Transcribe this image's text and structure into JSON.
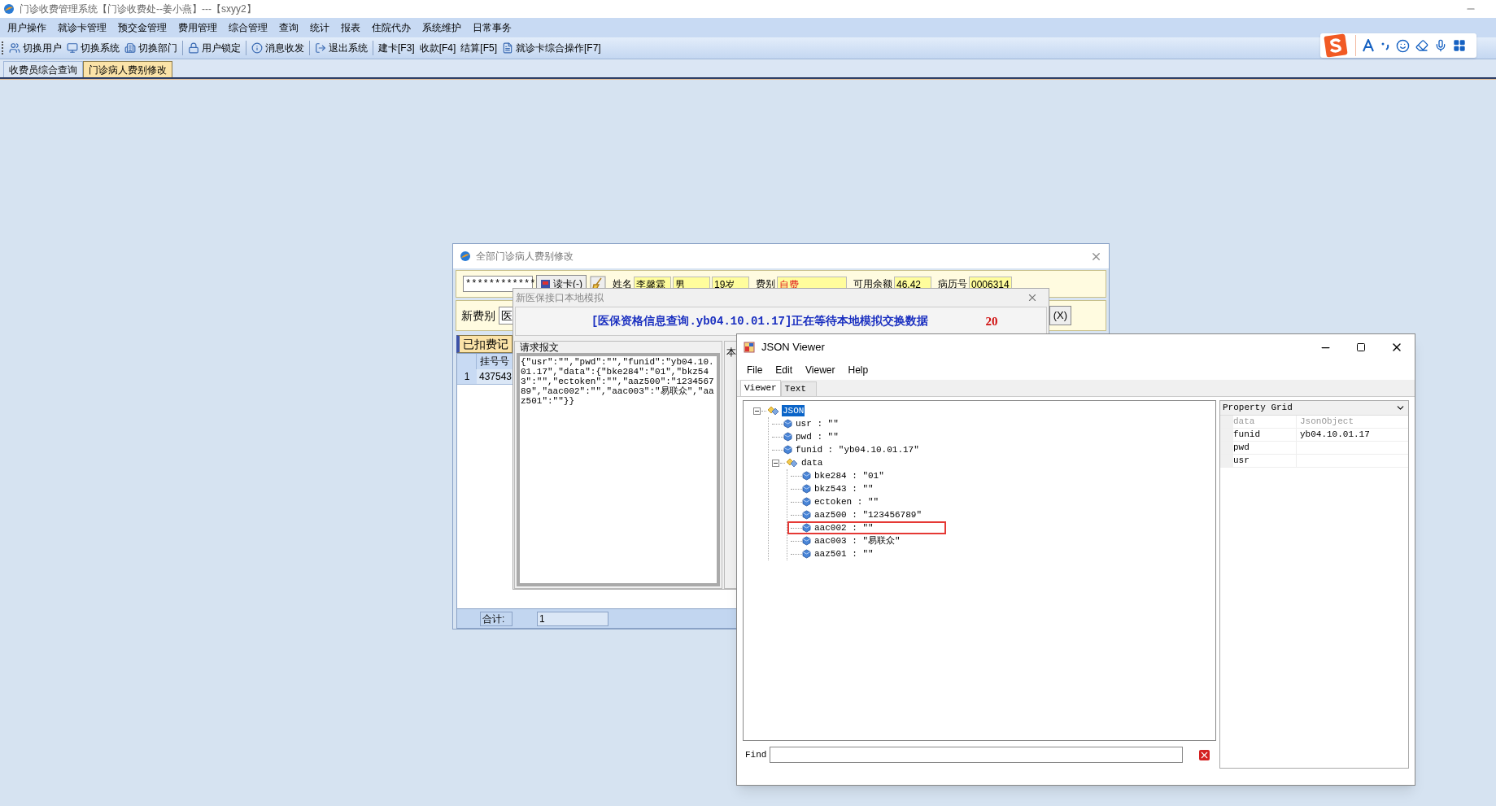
{
  "window": {
    "title": "门诊收费管理系统【门诊收费处--姜小燕】---【sxyy2】"
  },
  "menu": [
    "用户操作",
    "就诊卡管理",
    "预交金管理",
    "费用管理",
    "综合管理",
    "查询",
    "统计",
    "报表",
    "住院代办",
    "系统维护",
    "日常事务"
  ],
  "toolbar": [
    [
      {
        "label": "切换用户",
        "kind": "icon"
      },
      {
        "label": "切换系统",
        "kind": "icon"
      },
      {
        "label": "切换部门",
        "kind": "icon"
      }
    ],
    [
      {
        "label": "用户锁定",
        "kind": "icon"
      }
    ],
    [
      {
        "label": "消息收发",
        "kind": "icon"
      }
    ],
    [
      {
        "label": "退出系统",
        "kind": "icon"
      }
    ],
    [
      {
        "label": "建卡[F3]",
        "kind": "text"
      },
      {
        "label": "收款[F4]",
        "kind": "text"
      },
      {
        "label": "结算[F5]",
        "kind": "text"
      },
      {
        "label": "就诊卡综合操作[F7]",
        "kind": "icon"
      }
    ]
  ],
  "tabs": [
    {
      "label": "收费员综合查询",
      "selected": false
    },
    {
      "label": "门诊病人费别修改",
      "selected": true
    }
  ],
  "fee_dialog": {
    "title": "全部门诊病人费别修改",
    "card_number": "************",
    "read_button": "读卡(-)",
    "fields": [
      {
        "label": "姓名",
        "values": [
          "李馨霖",
          "男",
          "19岁"
        ],
        "alert": false
      },
      {
        "label": "费别",
        "values": [
          "自费"
        ],
        "alert": true
      },
      {
        "label": "可用余额",
        "values": [
          "46.42"
        ],
        "alert": false
      },
      {
        "label": "病历号",
        "values": [
          "0006314"
        ],
        "alert": false
      }
    ],
    "new_fee_label": "新费别",
    "new_fee_value": "医",
    "exit_button": "(X)",
    "records_tab": "已扣费记",
    "grid": {
      "columns": [
        "挂号号"
      ],
      "rows": [
        {
          "number": "1",
          "cells": [
            "437543"
          ]
        }
      ]
    },
    "footer": {
      "label": "合计:",
      "count": "1"
    }
  },
  "sim_dialog": {
    "title": "新医保接口本地模拟",
    "banner": "[医保资格信息查询.yb04.10.01.17]正在等待本地模拟交换数据",
    "countdown": "20",
    "request_group": "请求报文",
    "request_text": "{\"usr\":\"\",\"pwd\":\"\",\"funid\":\"yb04.10.01.17\",\"data\":{\"bke284\":\"01\",\"bkz543\":\"\",\"ectoken\":\"\",\"aaz500\":\"123456789\",\"aac002\":\"\",\"aac003\":\"易联众\",\"aaz501\":\"\"}}",
    "other_group": "本"
  },
  "json_viewer": {
    "title": "JSON Viewer",
    "menu": [
      "File",
      "Edit",
      "Viewer",
      "Help"
    ],
    "tabs": [
      {
        "label": "Viewer",
        "selected": true
      },
      {
        "label": "Text",
        "selected": false
      }
    ],
    "tree": {
      "label": "JSON",
      "kind": "object",
      "selected": true,
      "expanded": true,
      "highlighted": false,
      "children": [
        {
          "label": "usr : \"\"",
          "kind": "value",
          "selected": false,
          "highlighted": false
        },
        {
          "label": "pwd : \"\"",
          "kind": "value",
          "selected": false,
          "highlighted": false
        },
        {
          "label": "funid : \"yb04.10.01.17\"",
          "kind": "value",
          "selected": false,
          "highlighted": false
        },
        {
          "label": "data",
          "kind": "object",
          "selected": false,
          "expanded": true,
          "highlighted": false,
          "children": [
            {
              "label": "bke284 : \"01\"",
              "kind": "value",
              "selected": false,
              "highlighted": false
            },
            {
              "label": "bkz543 : \"\"",
              "kind": "value",
              "selected": false,
              "highlighted": false
            },
            {
              "label": "ectoken : \"\"",
              "kind": "value",
              "selected": false,
              "highlighted": false
            },
            {
              "label": "aaz500 : \"123456789\"",
              "kind": "value",
              "selected": false,
              "highlighted": false
            },
            {
              "label": "aac002 : \"\"",
              "kind": "value",
              "selected": false,
              "highlighted": true
            },
            {
              "label": "aac003 : \"易联众\"",
              "kind": "value",
              "selected": false,
              "highlighted": false
            },
            {
              "label": "aaz501 : \"\"",
              "kind": "value",
              "selected": false,
              "highlighted": false
            }
          ]
        }
      ]
    },
    "property_grid": {
      "title": "Property Grid",
      "rows": [
        {
          "name": "data",
          "value": "JsonObject",
          "disabled": true
        },
        {
          "name": "funid",
          "value": "yb04.10.01.17",
          "disabled": false
        },
        {
          "name": "pwd",
          "disabled": false
        },
        {
          "name": "usr",
          "disabled": false
        }
      ]
    },
    "find": {
      "label": "Find"
    }
  }
}
